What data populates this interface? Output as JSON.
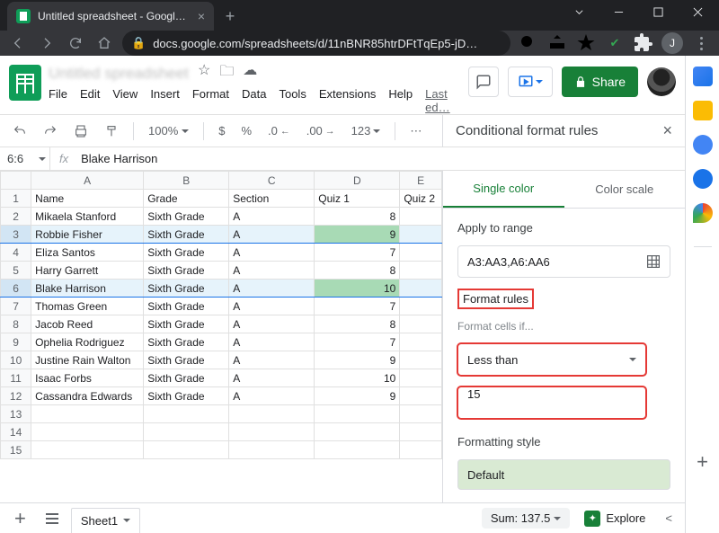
{
  "browser": {
    "tab_title": "Untitled spreadsheet - Google Sh",
    "url": "docs.google.com/spreadsheets/d/11nBNR85htrDFtTqEp5-jD…",
    "avatar_letter": "J"
  },
  "header": {
    "doc_title": "Untitled spreadsheet",
    "menus": [
      "File",
      "Edit",
      "View",
      "Insert",
      "Format",
      "Data",
      "Tools",
      "Extensions",
      "Help"
    ],
    "last_edit": "Last ed…",
    "share": "Share"
  },
  "toolbar": {
    "zoom": "100%",
    "num_format": "123"
  },
  "formula": {
    "namebox": "6:6",
    "fx": "fx",
    "value": "Blake Harrison"
  },
  "grid": {
    "col_headers": [
      "A",
      "B",
      "C",
      "D",
      "E"
    ],
    "header_row": [
      "Name",
      "Grade",
      "Section",
      "Quiz 1",
      "Quiz 2"
    ],
    "rows": [
      {
        "n": 1,
        "cells": [
          "Name",
          "Grade",
          "Section",
          "Quiz 1",
          "Quiz 2"
        ],
        "hdr": true
      },
      {
        "n": 2,
        "cells": [
          "Mikaela Stanford",
          "Sixth Grade",
          "A",
          "8",
          ""
        ]
      },
      {
        "n": 3,
        "cells": [
          "Robbie Fisher",
          "Sixth Grade",
          "A",
          "9",
          ""
        ],
        "hl": true
      },
      {
        "n": 4,
        "cells": [
          "Eliza Santos",
          "Sixth Grade",
          "A",
          "7",
          ""
        ]
      },
      {
        "n": 5,
        "cells": [
          "Harry Garrett",
          "Sixth Grade",
          "A",
          "8",
          ""
        ]
      },
      {
        "n": 6,
        "cells": [
          "Blake Harrison",
          "Sixth Grade",
          "A",
          "10",
          ""
        ],
        "hl": true
      },
      {
        "n": 7,
        "cells": [
          "Thomas Green",
          "Sixth Grade",
          "A",
          "7",
          ""
        ]
      },
      {
        "n": 8,
        "cells": [
          "Jacob Reed",
          "Sixth Grade",
          "A",
          "8",
          ""
        ]
      },
      {
        "n": 9,
        "cells": [
          "Ophelia Rodriguez",
          "Sixth Grade",
          "A",
          "7",
          ""
        ]
      },
      {
        "n": 10,
        "cells": [
          "Justine Rain Walton",
          "Sixth Grade",
          "A",
          "9",
          ""
        ]
      },
      {
        "n": 11,
        "cells": [
          "Isaac Forbs",
          "Sixth Grade",
          "A",
          "10",
          ""
        ]
      },
      {
        "n": 12,
        "cells": [
          "Cassandra Edwards",
          "Sixth Grade",
          "A",
          "9",
          ""
        ]
      },
      {
        "n": 13,
        "cells": [
          "",
          "",
          "",
          "",
          ""
        ]
      },
      {
        "n": 14,
        "cells": [
          "",
          "",
          "",
          "",
          ""
        ]
      },
      {
        "n": 15,
        "cells": [
          "",
          "",
          "",
          "",
          ""
        ]
      }
    ]
  },
  "cf": {
    "title": "Conditional format rules",
    "tab_single": "Single color",
    "tab_scale": "Color scale",
    "apply_to_range": "Apply to range",
    "range": "A3:AA3,A6:AA6",
    "format_rules": "Format rules",
    "format_cells_if": "Format cells if...",
    "condition": "Less than",
    "value": "15",
    "formatting_style": "Formatting style",
    "default": "Default"
  },
  "bottom": {
    "sheet": "Sheet1",
    "sum": "Sum: 137.5",
    "explore": "Explore"
  },
  "rail_colors": [
    "#1a73e8",
    "#fbbc04",
    "#4285f4",
    "#1a73e8",
    "#ea4335",
    "#34a853"
  ]
}
